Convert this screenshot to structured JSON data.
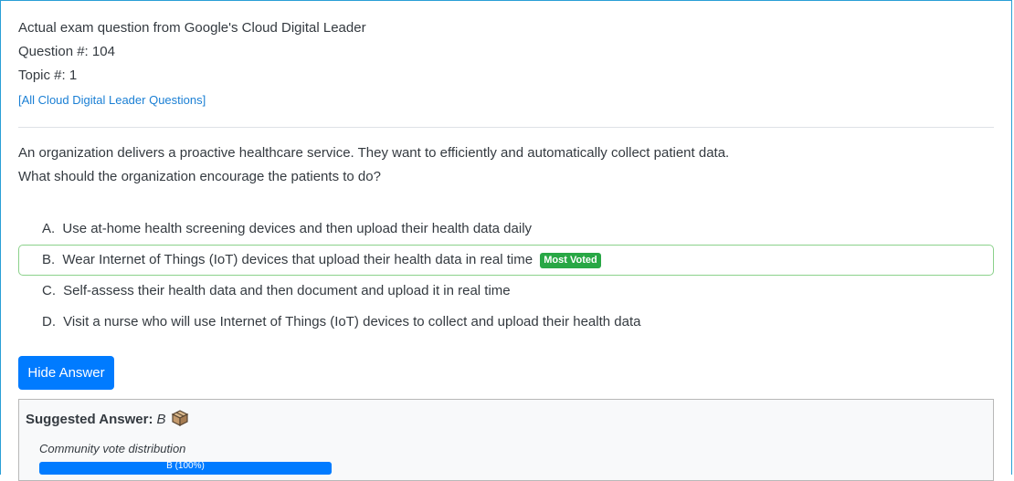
{
  "header": {
    "exam_line": "Actual exam question from Google's Cloud Digital Leader",
    "question_number": "Question #: 104",
    "topic": "Topic #: 1",
    "all_questions_link": "[All Cloud Digital Leader Questions]"
  },
  "question": {
    "line1": "An organization delivers a proactive healthcare service. They want to efficiently and automatically collect patient data.",
    "line2": "What should the organization encourage the patients to do?"
  },
  "choices": [
    {
      "letter": "A.",
      "text": "Use at-home health screening devices and then upload their health data daily",
      "most_voted": false
    },
    {
      "letter": "B.",
      "text": "Wear Internet of Things (IoT) devices that upload their health data in real time",
      "most_voted": true
    },
    {
      "letter": "C.",
      "text": "Self-assess their health data and then document and upload it in real time",
      "most_voted": false
    },
    {
      "letter": "D.",
      "text": "Visit a nurse who will use Internet of Things (IoT) devices to collect and upload their health data",
      "most_voted": false
    }
  ],
  "most_voted_badge": "Most Voted",
  "hide_answer_button": "Hide Answer",
  "answer": {
    "label": "Suggested Answer:",
    "value": "B",
    "icon": "discussion-box-icon",
    "distribution_label": "Community vote distribution",
    "votes": [
      {
        "label": "B (100%)",
        "percent": 100
      }
    ]
  },
  "colors": {
    "link": "#1a7fd4",
    "button": "#007bff",
    "badge": "#28a745",
    "voted_border": "#8bd18b",
    "frame_border": "#2a9fd6"
  }
}
